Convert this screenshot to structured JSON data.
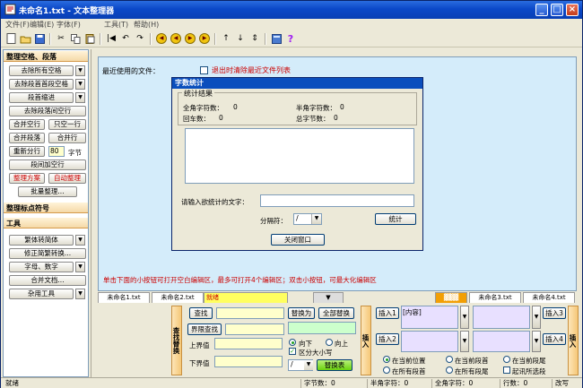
{
  "window": {
    "title": "未命名1.txt - 文本整理器"
  },
  "menu": [
    "文件(F)",
    "编辑(E)",
    "字体(F)",
    "工具(T)",
    "帮助(H)"
  ],
  "left_panel": {
    "section1": "整理空格、段落",
    "buttons": {
      "remove_all_spaces": "去除所有空格",
      "remove_start_end_spaces": "去除段首首段空格",
      "indent": "段首缩进",
      "remove_blank_lines": "去除段落间空行",
      "merge_blank_lines": "合并空行",
      "keep_one_line": "只空一行",
      "merge_paragraphs": "合并段落",
      "merge_lines": "合并行",
      "re_split": "重新分行",
      "split_value": "80",
      "chars_unit": "字节",
      "add_blank_lines": "段间加空行",
      "tidy_scheme": "整理方案",
      "auto_tidy": "自动整理",
      "batch_tidy": "批量整理..."
    },
    "section2": "整理标点符号",
    "section3": "工具",
    "tools": {
      "trad_simp": "繁体转简体",
      "fix_misspell": "修正简繁转换...",
      "letters_numbers": "字母、数字",
      "merge_docs": "合并文档...",
      "misc_tools": "杂用工具"
    }
  },
  "main": {
    "recent_label": "最近使用的文件：",
    "clear_recent": "退出时清除最近文件列表",
    "hint": "单击下面的小按钮可打开空白编辑区，最多可打开4个编辑区；双击小按钮，可最大化编辑区"
  },
  "dialog": {
    "title": "字数统计",
    "group": "统计结果",
    "full_width": "全角字符数：",
    "full_width_value": "0",
    "half_width": "半角字符数：",
    "half_width_value": "0",
    "enter_count": "回车数：",
    "enter_count_value": "0",
    "total_bytes": "总字节数：",
    "total_bytes_value": "0",
    "input_label": "请输入欲统计的文字：",
    "separator_label": "分隔符：",
    "separator_value": "/",
    "count_button": "统计",
    "close_button": "关闭窗口"
  },
  "tabs": [
    "未命名1.txt",
    "未命名2.txt",
    "就绪",
    "未命名3.txt",
    "未命名4.txt"
  ],
  "find_panel": {
    "tab_label": "查找替换",
    "find": "查找",
    "replace_with": "替换为",
    "replace_all": "全部替换",
    "range_find": "界限查找",
    "upper": "上界值",
    "lower": "下界值",
    "down": "向下",
    "up": "向上",
    "case_sensitive": "区分大小写",
    "replace_button": "替换表",
    "separator_value": "/"
  },
  "insert_panel": {
    "tab_label": "插入",
    "tab_label2": "插入",
    "insert1": "插入1",
    "insert2": "插入2",
    "insert3": "插入3",
    "insert4": "插入4",
    "field_text": "[内容]",
    "radio1": "在当前位置",
    "radio2": "在所有段首",
    "radio3": "在当前段首",
    "radio4": "在所有段尾",
    "radio5": "在当前段尾",
    "check": "起讯所选段"
  },
  "status": {
    "ready": "就绪",
    "byte_count": "字节数：0",
    "half_count": "半角字符：0",
    "full_count": "全角字符：0",
    "line_count": "行数：0",
    "encoding": "改写"
  }
}
